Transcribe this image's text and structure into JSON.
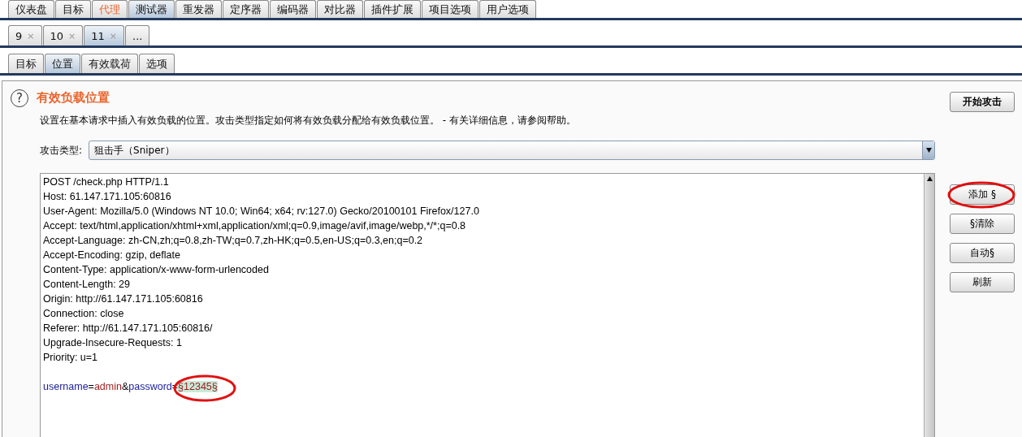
{
  "main_tabs": [
    {
      "label": "仪表盘",
      "selected": false,
      "alert": false
    },
    {
      "label": "目标",
      "selected": false,
      "alert": false
    },
    {
      "label": "代理",
      "selected": false,
      "alert": true
    },
    {
      "label": "测试器",
      "selected": true,
      "alert": false
    },
    {
      "label": "重发器",
      "selected": false,
      "alert": false
    },
    {
      "label": "定序器",
      "selected": false,
      "alert": false
    },
    {
      "label": "编码器",
      "selected": false,
      "alert": false
    },
    {
      "label": "对比器",
      "selected": false,
      "alert": false
    },
    {
      "label": "插件扩展",
      "selected": false,
      "alert": false
    },
    {
      "label": "项目选项",
      "selected": false,
      "alert": false
    },
    {
      "label": "用户选项",
      "selected": false,
      "alert": false
    }
  ],
  "attack_tabs": [
    {
      "label": "9",
      "close": "×",
      "selected": false
    },
    {
      "label": "10",
      "close": "×",
      "selected": false
    },
    {
      "label": "11",
      "close": "×",
      "selected": true
    },
    {
      "label": "..."
    }
  ],
  "sub_tabs": [
    {
      "label": "目标",
      "selected": false
    },
    {
      "label": "位置",
      "selected": true
    },
    {
      "label": "有效载荷",
      "selected": false
    },
    {
      "label": "选项",
      "selected": false
    }
  ],
  "section": {
    "help_icon": "?",
    "title": "有效负载位置",
    "description": "设置在基本请求中插入有效负载的位置。攻击类型指定如何将有效负载分配给有效负载位置。 - 有关详细信息，请参阅帮助。",
    "start_button": "开始攻击"
  },
  "attack_type": {
    "label": "攻击类型:",
    "value": "狙击手（Sniper）"
  },
  "request_lines": [
    "POST /check.php HTTP/1.1",
    "Host: 61.147.171.105:60816",
    "User-Agent: Mozilla/5.0 (Windows NT 10.0; Win64; x64; rv:127.0) Gecko/20100101 Firefox/127.0",
    "Accept: text/html,application/xhtml+xml,application/xml;q=0.9,image/avif,image/webp,*/*;q=0.8",
    "Accept-Language: zh-CN,zh;q=0.8,zh-TW;q=0.7,zh-HK;q=0.5,en-US;q=0.3,en;q=0.2",
    "Accept-Encoding: gzip, deflate",
    "Content-Type: application/x-www-form-urlencoded",
    "Content-Length: 29",
    "Origin: http://61.147.171.105:60816",
    "Connection: close",
    "Referer: http://61.147.171.105:60816/",
    "Upgrade-Insecure-Requests: 1",
    "Priority: u=1"
  ],
  "body_tokens": [
    {
      "kind": "name",
      "text": "username"
    },
    {
      "kind": "punct",
      "text": "="
    },
    {
      "kind": "value",
      "text": "admin"
    },
    {
      "kind": "punct",
      "text": "&"
    },
    {
      "kind": "name",
      "text": "password"
    },
    {
      "kind": "punct",
      "text": "="
    },
    {
      "kind": "payload",
      "text": "§12345§",
      "annotated": true
    }
  ],
  "side_buttons": [
    {
      "label": "添加 §",
      "annotated": true
    },
    {
      "label": "§清除",
      "annotated": false
    },
    {
      "label": "自动§",
      "annotated": false
    },
    {
      "label": "刷新",
      "annotated": false
    }
  ]
}
